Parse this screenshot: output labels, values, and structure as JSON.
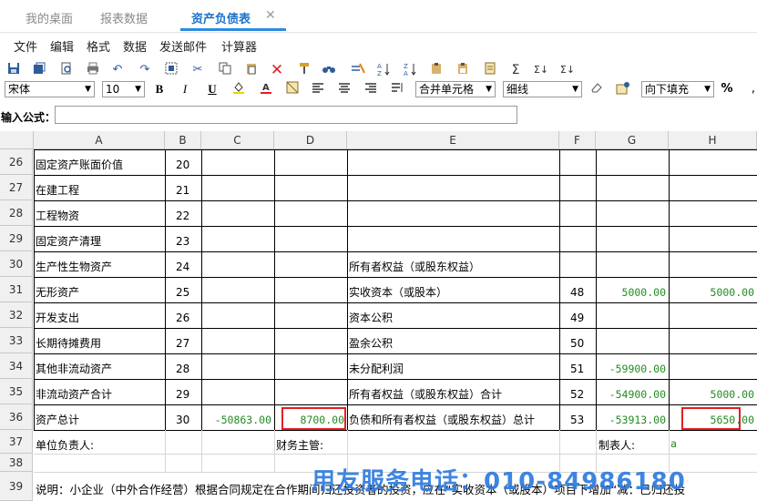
{
  "tabs": [
    {
      "label": "我的桌面"
    },
    {
      "label": "报表数据"
    },
    {
      "label": "资产负债表",
      "close": "✕"
    }
  ],
  "menu": [
    "文件",
    "编辑",
    "格式",
    "数据",
    "发送邮件",
    "计算器"
  ],
  "toolbar": {
    "font": "宋体",
    "size": "10",
    "merge": "合并单元格",
    "border": "细线",
    "fill": "向下填充",
    "percent": "%",
    "bold": "B",
    "italic": "I",
    "underline": "U",
    "sum1": "Σ",
    "sum2": "Σ↓",
    "sum3": "Σ↓"
  },
  "formula": {
    "label": "输入公式："
  },
  "columns": [
    "A",
    "B",
    "C",
    "D",
    "E",
    "F",
    "G",
    "H"
  ],
  "rows": [
    {
      "n": "26",
      "a": "固定资产账面价值",
      "b": "20",
      "c": "",
      "d": "",
      "e": "",
      "f": "",
      "g": "",
      "h": ""
    },
    {
      "n": "27",
      "a": "在建工程",
      "b": "21",
      "c": "",
      "d": "",
      "e": "",
      "f": "",
      "g": "",
      "h": ""
    },
    {
      "n": "28",
      "a": "工程物资",
      "b": "22",
      "c": "",
      "d": "",
      "e": "",
      "f": "",
      "g": "",
      "h": ""
    },
    {
      "n": "29",
      "a": "固定资产清理",
      "b": "23",
      "c": "",
      "d": "",
      "e": "",
      "f": "",
      "g": "",
      "h": ""
    },
    {
      "n": "30",
      "a": "生产性生物资产",
      "b": "24",
      "c": "",
      "d": "",
      "e": "所有者权益（或股东权益）",
      "f": "",
      "g": "",
      "h": ""
    },
    {
      "n": "31",
      "a": "无形资产",
      "b": "25",
      "c": "",
      "d": "",
      "e": "实收资本（或股本）",
      "f": "48",
      "g": "5000.00",
      "h": "5000.00"
    },
    {
      "n": "32",
      "a": "开发支出",
      "b": "26",
      "c": "",
      "d": "",
      "e": "资本公积",
      "f": "49",
      "g": "",
      "h": ""
    },
    {
      "n": "33",
      "a": "长期待摊费用",
      "b": "27",
      "c": "",
      "d": "",
      "e": "盈余公积",
      "f": "50",
      "g": "",
      "h": ""
    },
    {
      "n": "34",
      "a": "其他非流动资产",
      "b": "28",
      "c": "",
      "d": "",
      "e": "未分配利润",
      "f": "51",
      "g": "-59900.00",
      "h": ""
    },
    {
      "n": "35",
      "a": "非流动资产合计",
      "b": "29",
      "c": "",
      "d": "",
      "e": "所有者权益（或股东权益）合计",
      "f": "52",
      "g": "-54900.00",
      "h": "5000.00"
    },
    {
      "n": "36",
      "a": "资产总计",
      "b": "30",
      "c": "-50863.00",
      "d": "8700.00",
      "e": "负债和所有者权益（或股东权益）总计",
      "f": "53",
      "g": "-53913.00",
      "h": "5650.00"
    }
  ],
  "row37": {
    "n": "37",
    "a": "单位负责人:",
    "d": "财务主管:",
    "g": "制表人:",
    "h": "a"
  },
  "row38": {
    "n": "38"
  },
  "row39": {
    "n": "39",
    "a": "说明：小企业（中外合作经营）根据合同规定在合作期间归还投资者的投资，应在“实收资本（或股本）”项目下增加“减：已归还投"
  },
  "watermark": "用友服务电话：010-84986180"
}
